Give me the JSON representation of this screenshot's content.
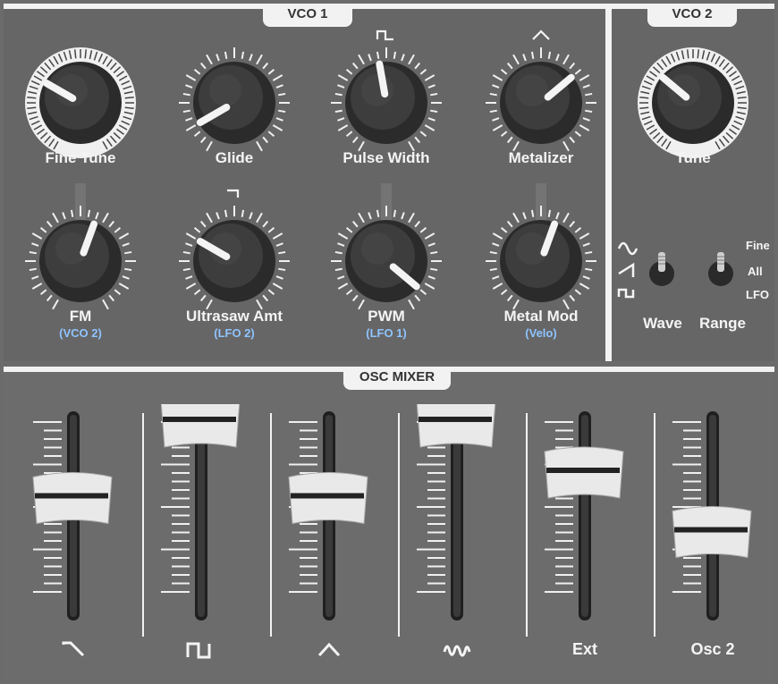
{
  "vco1": {
    "title": "VCO 1",
    "knobs": [
      {
        "id": "fine-tune",
        "label": "Fine Tune",
        "sub": "",
        "angle": -60,
        "style": "white-ring"
      },
      {
        "id": "glide",
        "label": "Glide",
        "sub": "",
        "angle": -120,
        "style": "dark"
      },
      {
        "id": "pulse-width",
        "label": "Pulse Width",
        "sub": "",
        "angle": -10,
        "style": "dark",
        "top_symbol": "square-wave"
      },
      {
        "id": "metalizer",
        "label": "Metalizer",
        "sub": "",
        "angle": 50,
        "style": "dark",
        "top_symbol": "triangle-wave"
      },
      {
        "id": "fm",
        "label": "FM",
        "sub": "(VCO 2)",
        "angle": 20,
        "style": "dark"
      },
      {
        "id": "ultrasaw-amt",
        "label": "Ultrasaw Amt",
        "sub": "(LFO 2)",
        "angle": -60,
        "style": "dark",
        "top_symbol": "saw-wave"
      },
      {
        "id": "pwm",
        "label": "PWM",
        "sub": "(LFO 1)",
        "angle": 130,
        "style": "dark"
      },
      {
        "id": "metal-mod",
        "label": "Metal Mod",
        "sub": "(Velo)",
        "angle": 20,
        "style": "dark"
      }
    ]
  },
  "vco2": {
    "title": "VCO 2",
    "knob": {
      "id": "tune",
      "label": "Tune",
      "angle": -50,
      "style": "white-ring"
    },
    "wave_switch": {
      "label": "Wave",
      "options_icons": [
        "sine-wave",
        "saw-wave",
        "square-wave"
      ]
    },
    "range_switch": {
      "label": "Range",
      "options": [
        "Fine",
        "All",
        "LFO"
      ]
    }
  },
  "mixer": {
    "title": "OSC MIXER",
    "faders": [
      {
        "id": "saw",
        "label": "",
        "icon": "saw-wave-icon",
        "level": 0.55
      },
      {
        "id": "square",
        "label": "",
        "icon": "square-wave-icon",
        "level": 1.0
      },
      {
        "id": "triangle",
        "label": "",
        "icon": "triangle-wave-icon",
        "level": 0.55
      },
      {
        "id": "noise",
        "label": "",
        "icon": "noise-wave-icon",
        "level": 1.0
      },
      {
        "id": "ext",
        "label": "Ext",
        "icon": "",
        "level": 0.7
      },
      {
        "id": "osc2",
        "label": "Osc 2",
        "icon": "",
        "level": 0.35
      }
    ]
  },
  "colors": {
    "accent_blue": "#8fc4ff",
    "panel": "#666666",
    "frame": "#f2f2f2"
  }
}
